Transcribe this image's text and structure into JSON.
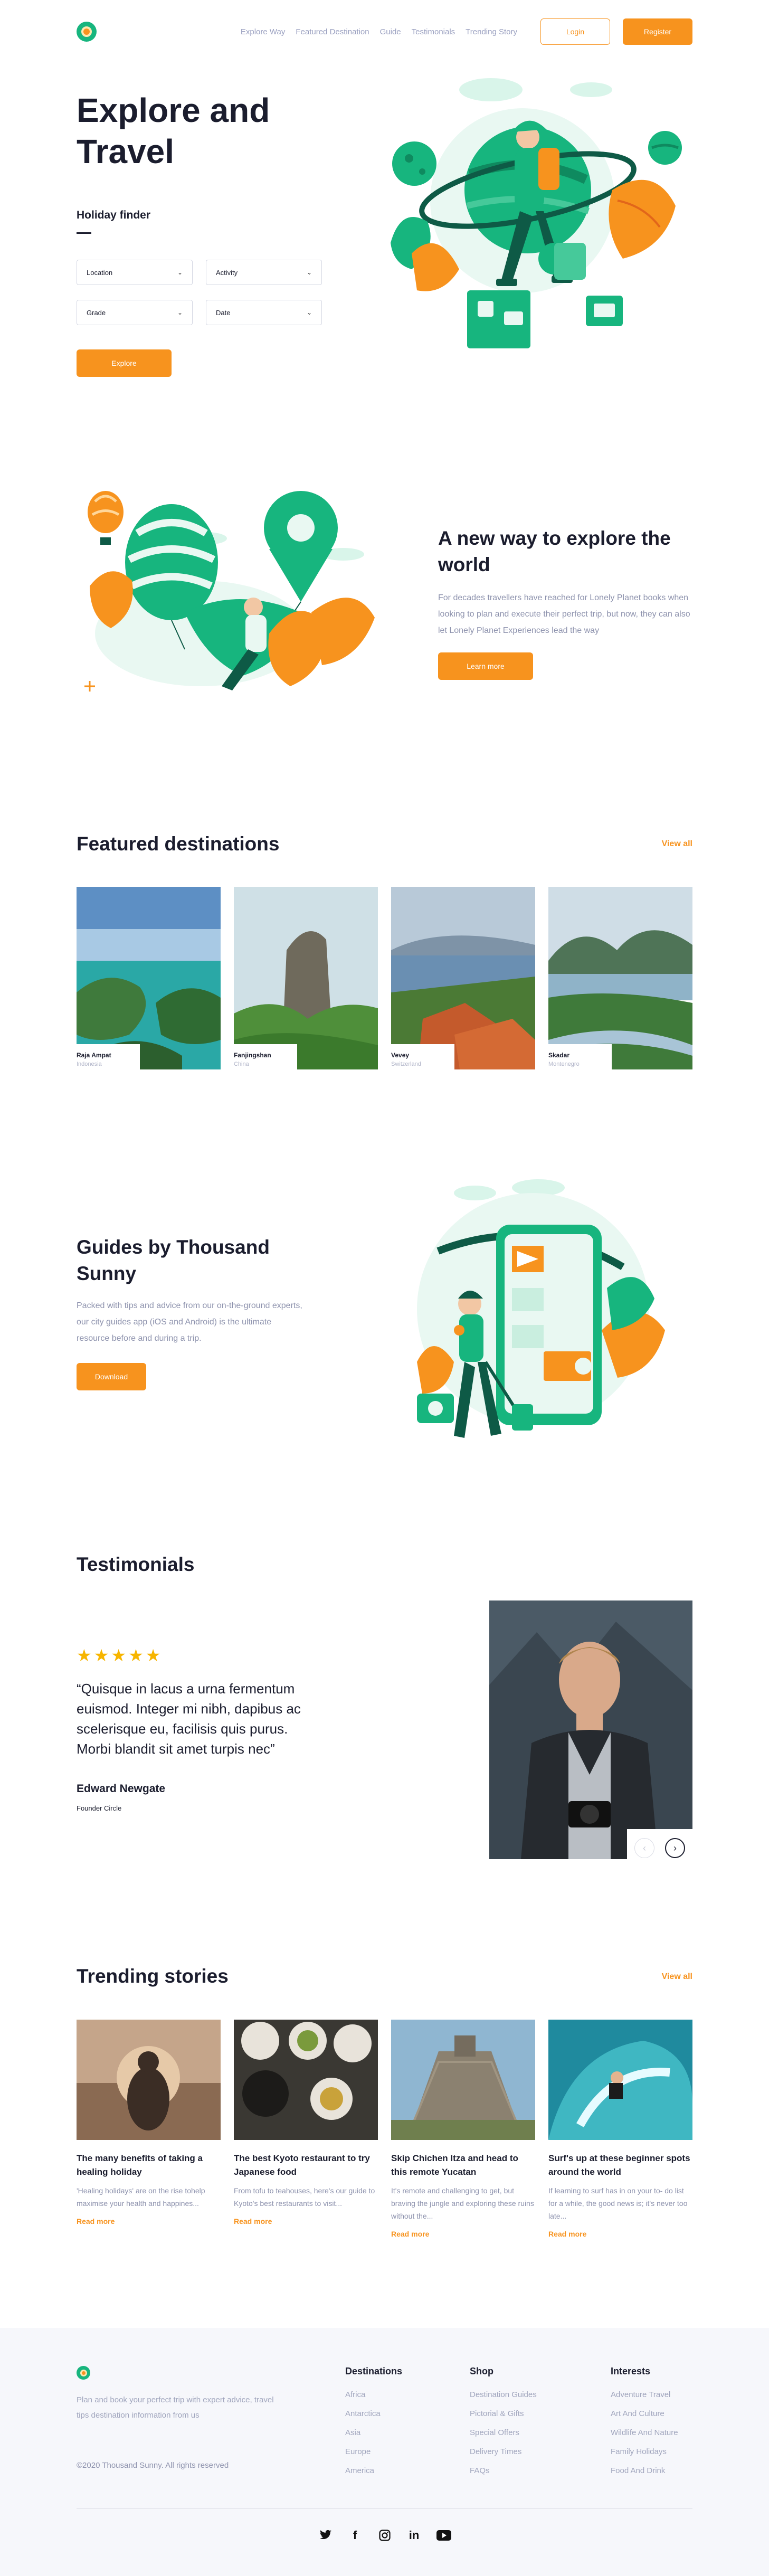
{
  "brand": {
    "accent": "#f7931e",
    "green": "#17b57e",
    "dark": "#1b1d2e",
    "muted": "#8d92ad"
  },
  "nav": {
    "links": [
      "Explore Way",
      "Featured Destination",
      "Guide",
      "Testimonials",
      "Trending Story"
    ],
    "login": "Login",
    "register": "Register"
  },
  "hero": {
    "title": "Explore and Travel",
    "finder_label": "Holiday finder",
    "fields": [
      {
        "label": "Location"
      },
      {
        "label": "Activity"
      },
      {
        "label": "Grade"
      },
      {
        "label": "Date"
      }
    ],
    "explore": "Explore"
  },
  "explore_way": {
    "title": "A new way to explore the world",
    "text": "For decades travellers have reached for Lonely Planet books when looking to plan and execute their perfect trip, but now, they can also let Lonely Planet Experiences lead the way",
    "button": "Learn more"
  },
  "featured": {
    "title": "Featured destinations",
    "view_all": "View all",
    "items": [
      {
        "name": "Raja Ampat",
        "country": "Indonesia"
      },
      {
        "name": "Fanjingshan",
        "country": "China"
      },
      {
        "name": "Vevey",
        "country": "Switzerland"
      },
      {
        "name": "Skadar",
        "country": "Montenegro"
      }
    ]
  },
  "guides": {
    "title": "Guides by Thousand Sunny",
    "text": "Packed with tips and advice from our on-the-ground experts, our city guides app (iOS and Android) is the ultimate resource before and during a trip.",
    "button": "Download"
  },
  "testimonials": {
    "title": "Testimonials",
    "rating": 5,
    "stars": [
      "★",
      "★",
      "★",
      "★",
      "★"
    ],
    "quote": "“Quisque in lacus a urna fermentum euismod. Integer mi nibh, dapibus ac scelerisque eu, facilisis quis purus. Morbi blandit sit amet turpis nec”",
    "name": "Edward Newgate",
    "role": "Founder Circle",
    "prev_icon": "‹",
    "next_icon": "›"
  },
  "trending": {
    "title": "Trending stories",
    "view_all": "View all",
    "items": [
      {
        "title": "The many benefits of taking a healing holiday",
        "text": "'Healing holidays' are on the rise tohelp maximise your health and happines...",
        "more": "Read more"
      },
      {
        "title": "The best Kyoto restaurant to try Japanese food",
        "text": "From tofu to teahouses, here's our guide to Kyoto's best restaurants to visit...",
        "more": "Read more"
      },
      {
        "title": "Skip Chichen Itza and head to this remote Yucatan",
        "text": "It's remote and challenging to get, but braving the jungle and exploring these ruins without the...",
        "more": "Read more"
      },
      {
        "title": "Surf's up at these beginner spots around the world",
        "text": "If learning to surf has in on your to- do list for a while, the good news is; it's never too late...",
        "more": "Read more"
      }
    ]
  },
  "footer": {
    "about": "Plan and book your perfect trip with expert advice, travel tips destination information from us",
    "copyright": "©2020 Thousand Sunny. All rights reserved",
    "columns": [
      {
        "title": "Destinations",
        "items": [
          "Africa",
          "Antarctica",
          "Asia",
          "Europe",
          "America"
        ]
      },
      {
        "title": "Shop",
        "items": [
          "Destination Guides",
          "Pictorial & Gifts",
          "Special Offers",
          "Delivery Times",
          "FAQs"
        ]
      },
      {
        "title": "Interests",
        "items": [
          "Adventure Travel",
          "Art And Culture",
          "Wildlife And Nature",
          "Family Holidays",
          "Food And Drink"
        ]
      }
    ],
    "socials": [
      "twitter-icon",
      "facebook-icon",
      "instagram-icon",
      "linkedin-icon",
      "youtube-icon"
    ],
    "social_glyphs": [
      "🐦",
      "f",
      "◎",
      "in",
      "▶"
    ]
  }
}
